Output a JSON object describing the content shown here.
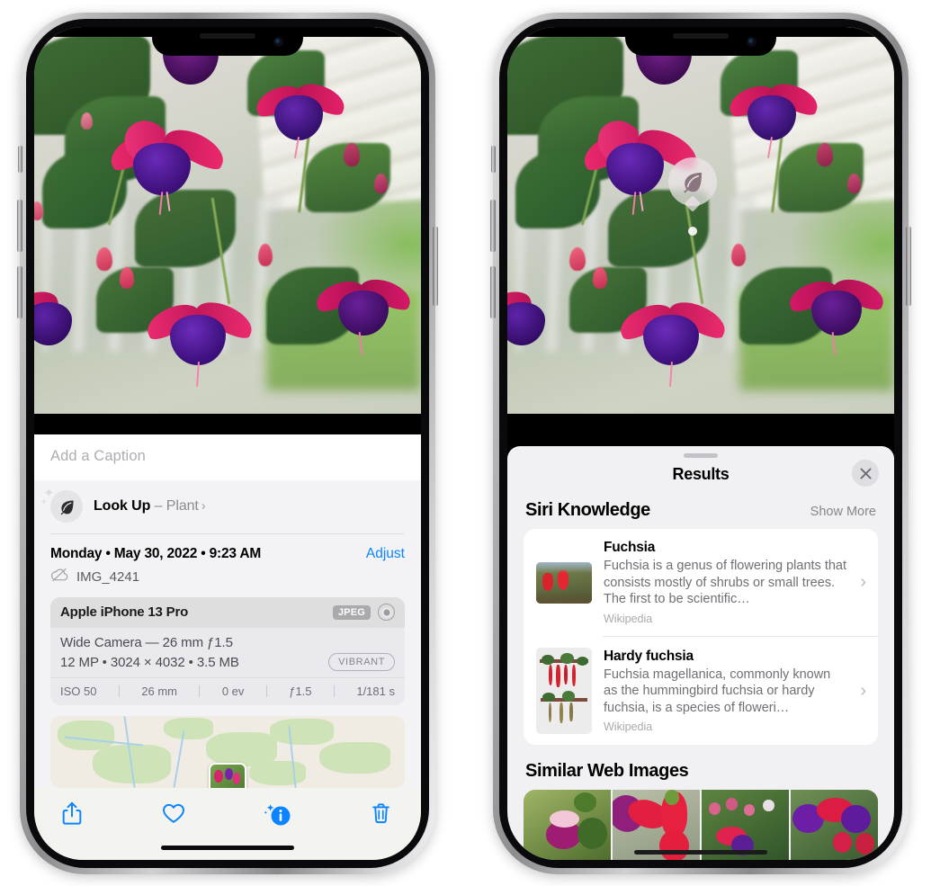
{
  "left_phone": {
    "caption_placeholder": "Add a Caption",
    "lookup": {
      "label": "Look Up",
      "separator": " – ",
      "kind": "Plant",
      "chevron": "›",
      "icon": "leaf-icon"
    },
    "date_text": "Monday • May 30, 2022 • 9:23 AM",
    "adjust_label": "Adjust",
    "file_name": "IMG_4241",
    "cloud_icon": "cloud-slash-icon",
    "metadata": {
      "device": "Apple iPhone 13 Pro",
      "format_badge": "JPEG",
      "lens_icon": "camera-lens-icon",
      "lens_line": "Wide Camera — 26 mm ƒ1.5",
      "spec_line": "12 MP • 3024 × 4032 • 3.5 MB",
      "style_badge": "VIBRANT",
      "exif": [
        "ISO 50",
        "26 mm",
        "0 ev",
        "ƒ1.5",
        "1/181 s"
      ]
    },
    "toolbar": [
      {
        "name": "share-button",
        "icon": "share-icon"
      },
      {
        "name": "favorite-button",
        "icon": "heart-icon"
      },
      {
        "name": "info-button",
        "icon": "info-sparkle-icon"
      },
      {
        "name": "delete-button",
        "icon": "trash-icon"
      }
    ],
    "accent_color": "#0a84ff"
  },
  "right_phone": {
    "visual_look_up_badge": "leaf-icon",
    "sheet_title": "Results",
    "close_icon": "close-icon",
    "siri_knowledge": {
      "title": "Siri Knowledge",
      "show_more": "Show More",
      "items": [
        {
          "title": "Fuchsia",
          "description": "Fuchsia is a genus of flowering plants that consists mostly of shrubs or small trees. The first to be scientific…",
          "source": "Wikipedia",
          "thumb": "fuchsia-red-flowers-thumbnail"
        },
        {
          "title": "Hardy fuchsia",
          "description": "Fuchsia magellanica, commonly known as the hummingbird fuchsia or hardy fuchsia, is a species of floweri…",
          "source": "Wikipedia",
          "thumb": "hardy-fuchsia-specimen-thumbnail"
        }
      ]
    },
    "similar_web_images": {
      "title": "Similar Web Images",
      "thumbnails": [
        "fuchsia-magenta-bloom-thumbnail",
        "fuchsia-red-closeup-thumbnail",
        "fuchsia-bush-buds-thumbnail",
        "fuchsia-purple-pink-thumbnail"
      ]
    }
  }
}
